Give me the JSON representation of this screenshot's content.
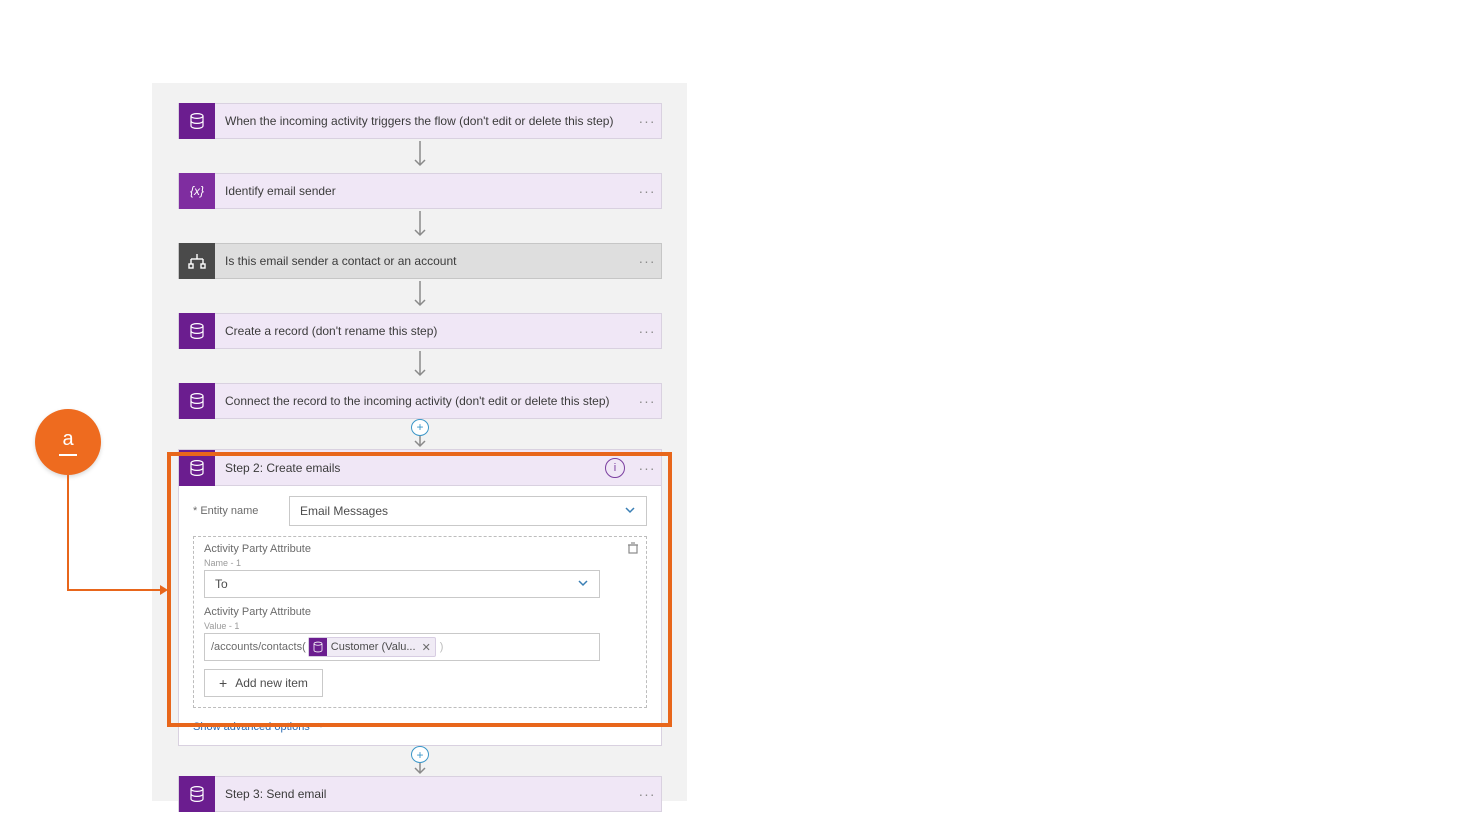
{
  "callout": {
    "label": "a"
  },
  "steps": {
    "trigger": {
      "label": "When the incoming activity triggers the flow (don't edit or delete this step)"
    },
    "identify": {
      "label": "Identify email sender"
    },
    "switch": {
      "label": "Is this email sender a contact or an account"
    },
    "create_record": {
      "label": "Create a record (don't rename this step)"
    },
    "connect": {
      "label": "Connect the record to the incoming activity (don't edit or delete this step)"
    },
    "send": {
      "label": "Step 3: Send email"
    }
  },
  "step2": {
    "title": "Step 2: Create emails",
    "entity_label": "Entity name",
    "entity_value": "Email Messages",
    "section1_label": "Activity Party Attribute",
    "section1_sub": "Name - 1",
    "to_value": "To",
    "section2_label": "Activity Party Attribute",
    "section2_sub": "Value - 1",
    "pretext": "/accounts/contacts(",
    "token_text": "Customer (Valu...",
    "paren_close": ")",
    "add_item": "Add new item",
    "advanced": "Show advanced options"
  }
}
